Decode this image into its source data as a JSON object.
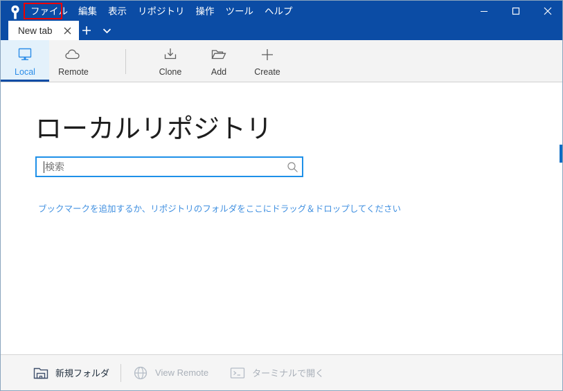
{
  "window": {
    "accent_color": "#0b4ca5",
    "annotation_color": "#ee0000",
    "controls": {
      "minimize_label": "Minimize",
      "maximize_label": "Maximize",
      "close_label": "Close"
    },
    "logo_icon": "sourcetree-logo-icon"
  },
  "menu": {
    "items": [
      {
        "label": "ファイル",
        "highlighted": true
      },
      {
        "label": "編集",
        "highlighted": false
      },
      {
        "label": "表示",
        "highlighted": false
      },
      {
        "label": "リポジトリ",
        "highlighted": false
      },
      {
        "label": "操作",
        "highlighted": false
      },
      {
        "label": "ツール",
        "highlighted": false
      },
      {
        "label": "ヘルプ",
        "highlighted": false
      }
    ]
  },
  "tabs": {
    "items": [
      {
        "label": "New tab",
        "active": true,
        "close_icon": "close-icon"
      }
    ],
    "new_tab_icon": "plus-icon",
    "tab_list_icon": "chevron-down-icon"
  },
  "toolbar": {
    "items": [
      {
        "label": "Local",
        "icon": "monitor-icon",
        "selected": true
      },
      {
        "label": "Remote",
        "icon": "cloud-icon",
        "selected": false
      },
      {
        "label": "Clone",
        "icon": "download-icon",
        "selected": false
      },
      {
        "label": "Add",
        "icon": "folder-open-icon",
        "selected": false
      },
      {
        "label": "Create",
        "icon": "plus-icon",
        "selected": false
      }
    ]
  },
  "main": {
    "title": "ローカルリポジトリ",
    "search": {
      "value": "",
      "placeholder": "検索",
      "icon": "search-icon",
      "focused": true,
      "border_color": "#1e90e8"
    },
    "hint_link": "ブックマークを追加するか、リポジトリのフォルダをここにドラッグ＆ドロップしてください",
    "hint_link_color": "#3f8fe0"
  },
  "bottombar": {
    "items": [
      {
        "label": "新規フォルダ",
        "icon": "new-folder-icon",
        "enabled": true
      },
      {
        "label": "View Remote",
        "icon": "globe-icon",
        "enabled": false
      },
      {
        "label": "ターミナルで開く",
        "icon": "terminal-icon",
        "enabled": false
      }
    ]
  }
}
